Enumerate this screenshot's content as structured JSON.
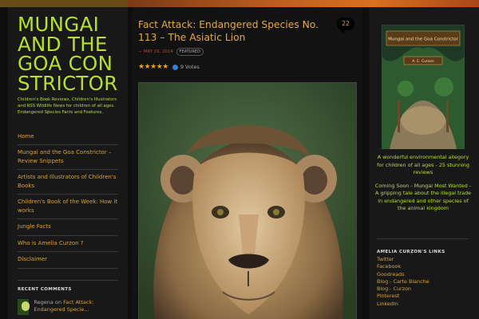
{
  "site": {
    "title": "MUNGAI AND THE GOA CONSTRICTOR",
    "description": "Children's Book Reviews, Children's Illustrators and RSS Wildlife News for children of all ages. Endangered Species Facts and Features."
  },
  "nav": [
    {
      "label": "Home"
    },
    {
      "label": "Mungai and the Goa Constrictor – Review Snippets"
    },
    {
      "label": "Artists and Illustrators of Children's Books"
    },
    {
      "label": "Children's Book of the Week: How it works"
    },
    {
      "label": "Jungle Facts"
    },
    {
      "label": "Who is Amelia Curzon ?"
    },
    {
      "label": "Disclaimer"
    }
  ],
  "recent_comments": {
    "title": "RECENT COMMENTS",
    "items": [
      {
        "author": "Regena",
        "on": "on",
        "link": "Fact Attack: Endangered Specie..."
      }
    ]
  },
  "post": {
    "title": "Fact Attack: Endangered Species No. 113 – The Asiatic Lion",
    "comment_count": "22",
    "date": "— MAY 19, 2014",
    "category": "FEATURED",
    "votes": "9 Votes",
    "stars": "★★★★★",
    "rating": 5
  },
  "sidebar": {
    "book_title": "Mungai and the Goa Constrictor",
    "book_author": "A. E. Curzon",
    "ad_text_1": "A wonderful environmental allegory for children of all ages - 25 stunning reviews",
    "ad_text_2": "Coming Soon - Mungai Most Wanted - A gripping tale about the illegal trade in endangered and other species of the animal kingdom",
    "links_title": "AMELIA CURZON'S LINKS",
    "links": [
      "Twitter",
      "Facebook",
      "Goodreads",
      "Blog - Carte Blanche",
      "Blog - Curzon",
      "Pinterest",
      "LinkedIn"
    ]
  },
  "colors": {
    "accent_green": "#b6e02a",
    "link_orange": "#d9a230",
    "title_orange": "#e8a838",
    "background": "#0e0e0e"
  }
}
